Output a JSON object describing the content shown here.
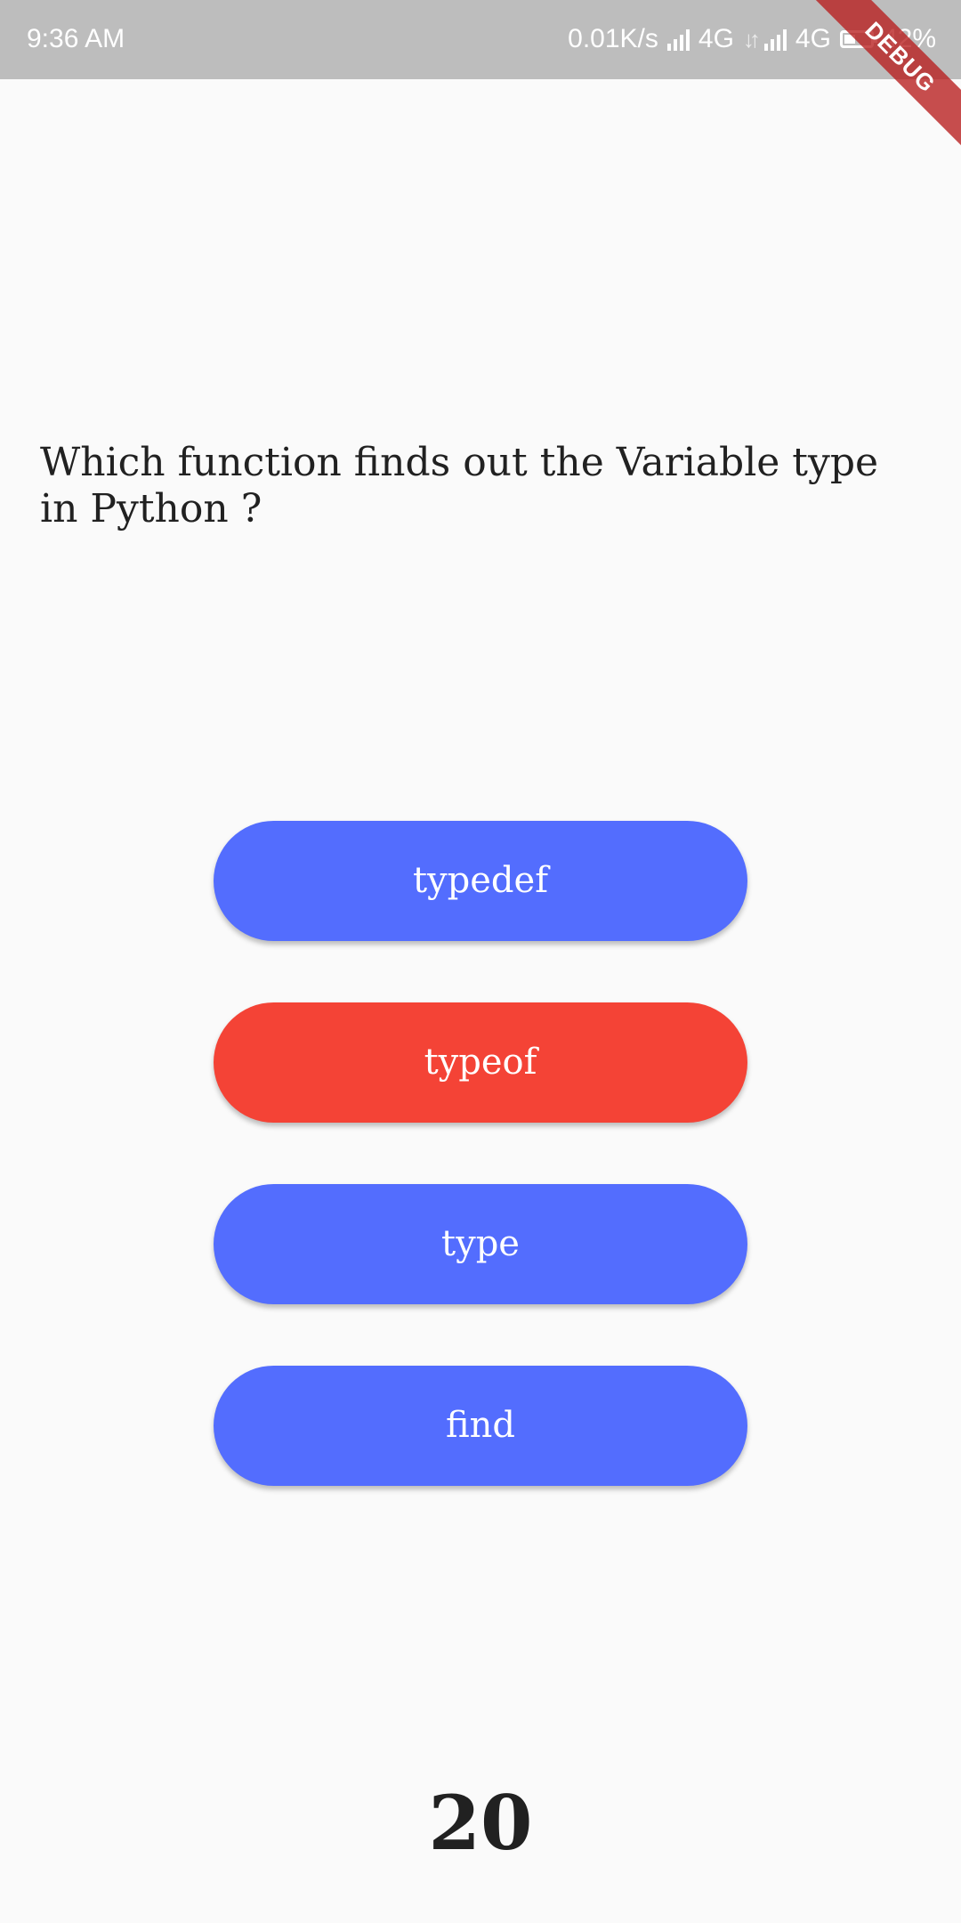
{
  "status_bar": {
    "time": "9:36 AM",
    "speed": "0.01K/s",
    "network1": "4G",
    "network2": "4G",
    "battery": "42%",
    "icons": [
      "signal-icon",
      "sync-icon",
      "signal-icon",
      "battery-icon"
    ]
  },
  "debug_banner": "DEBUG",
  "quiz": {
    "question": "Which function finds out the Variable type in Python ?",
    "answers": [
      {
        "label": "typedef",
        "color": "#536dfe"
      },
      {
        "label": "typeof",
        "color": "#f44336"
      },
      {
        "label": "type",
        "color": "#536dfe"
      },
      {
        "label": "find",
        "color": "#536dfe"
      }
    ],
    "counter": "20"
  }
}
